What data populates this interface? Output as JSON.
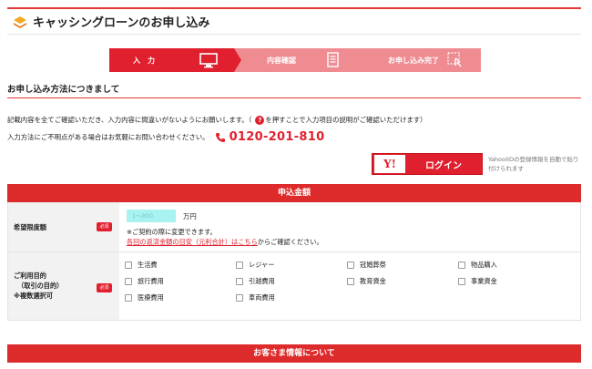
{
  "header": {
    "title": "キャッシングローンのお申し込み",
    "icon": "layers-icon"
  },
  "steps": [
    {
      "label": "入　力",
      "icon": "monitor-icon",
      "active": true
    },
    {
      "label": "内容確認",
      "icon": "document-icon",
      "active": false
    },
    {
      "label": "お申し込み完了",
      "icon": "touch-icon",
      "active": false
    }
  ],
  "section": {
    "title": "お申し込み方法につきまして"
  },
  "intro": {
    "line1_a": "記載内容を全てご確認いただき、入力内容に間違いがないようにお願いします。（",
    "line1_icon": "?",
    "line1_b": "を押すことで入力項目の説明がご確認いただけます）",
    "line2": "入力方法にご不明点がある場合はお気軽にお問い合わせください。",
    "phone": "0120-201-810"
  },
  "login": {
    "logo": "Y!",
    "label": "ログイン",
    "note": "YahooIIDの登録情報を自動で貼り付けられます"
  },
  "amount_section": {
    "title": "申込金額"
  },
  "desired_limit": {
    "label": "希望限度額",
    "required": "必須",
    "placeholder": "1～800",
    "unit": "万円",
    "note1": "※ご契約の際に変更できます。",
    "note2_link": "各回の返済金額の目安（元利合計）はこちら",
    "note2_rest": "からご確認ください。"
  },
  "purpose": {
    "label_line1": "ご利用目的",
    "label_line2": "（取引の目的）",
    "label_line3": "※複数選択可",
    "required": "必須",
    "options": [
      "生活費",
      "レジャー",
      "冠婚葬祭",
      "物品購入",
      "旅行費用",
      "引越費用",
      "教育資金",
      "事業資金",
      "医療費用",
      "車両費用"
    ]
  },
  "customer_section": {
    "title": "お客さま情報について"
  },
  "colors": {
    "accent": "#e0202e",
    "step_inactive": "#ef8c92",
    "input_bg": "#a8f2f2"
  }
}
